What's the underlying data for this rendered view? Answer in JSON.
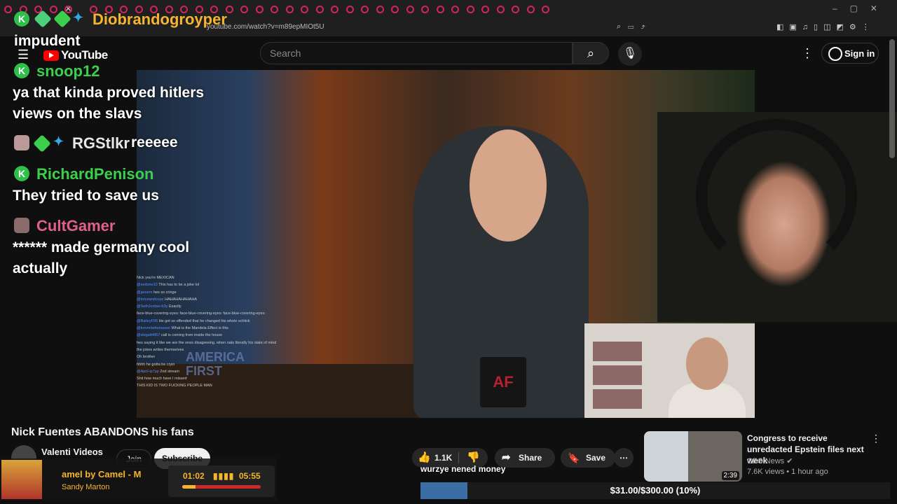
{
  "browser": {
    "url": "youtube.com/watch?v=m89epMIOt5U"
  },
  "youtube": {
    "logo_text": "YouTube",
    "search_placeholder": "Search",
    "sign_in": "Sign in"
  },
  "overlay_chat": {
    "messages": [
      {
        "user": "Diobrandogroyper",
        "color": "#f5b52e",
        "text": "impudent"
      },
      {
        "user": "snoop12",
        "color": "#3ccf4e",
        "text": "ya that kinda proved hitlers views on the slavs"
      },
      {
        "user": "RGStlkr",
        "color": "#e8e8e8",
        "text": "reeeee"
      },
      {
        "user": "RichardPenison",
        "color": "#3ccf4e",
        "text": "They tried to save us"
      },
      {
        "user": "CultGamer",
        "color": "#e0608a",
        "text": "****** made germany cool actually"
      }
    ]
  },
  "video_chat": {
    "lines": [
      {
        "user": "",
        "text": "Nick you're MEXICAN"
      },
      {
        "user": "@sedone10",
        "text": "This has to be a joke lol"
      },
      {
        "user": "@jareem",
        "text": "hes so cringe"
      },
      {
        "user": "@briceandcope",
        "text": "HAHAHAHAHAHA"
      },
      {
        "user": "@SethJordan-b3y",
        "text": "Exactly"
      },
      {
        "user": "",
        "text": "face-blue-covering-eyes: face-blue-covering-eyes: face-blue-covering-eyes:"
      },
      {
        "user": "@BaileyF96",
        "text": "He got so offended that he changed his whole schtick"
      },
      {
        "user": "@trevorbettsmason",
        "text": "What is the Mandela Effect is this"
      },
      {
        "user": "@sbigail4957",
        "text": "call is coming from inside the house"
      },
      {
        "user": "",
        "text": "hes saying it like we are the ones disagreeing. when nats literally his state of mind"
      },
      {
        "user": "",
        "text": "the jokes writes themselves"
      },
      {
        "user": "",
        "text": "Oh brother"
      },
      {
        "user": "",
        "text": "hhhh he gotta be cryin"
      },
      {
        "user": "@April-ip7pp",
        "text": "2nd stream"
      },
      {
        "user": "",
        "text": "Shit how much have I missed"
      },
      {
        "user": "",
        "text": "THIS KID IS TWO FUCKING PEOPLE MAN"
      }
    ],
    "flag_text": "AMERICA FIRST",
    "mug_text": "AF"
  },
  "watch": {
    "title": "Nick Fuentes ABANDONS his fans",
    "channel": "Valenti Videos",
    "join": "Join",
    "subscribe": "Subscribe",
    "likes": "1.1K",
    "share": "Share",
    "save": "Save"
  },
  "recommendation": {
    "title": "Congress to receive unredacted Epstein files next week",
    "channel": "CBS News",
    "meta": "7.6K views • 1 hour ago",
    "duration": "2:39"
  },
  "music_widget": {
    "title": "amel by Camel - M",
    "artist": "Sandy Marton",
    "current": "01:02",
    "total": "05:55",
    "progress": 0.17
  },
  "caption": "wurzye nened money",
  "goal": {
    "text": "$31.00/$300.00 (10%)",
    "progress": 0.1
  },
  "colors": {
    "youtube_red": "#ff0000",
    "goal_fill": "#3b6ea5",
    "music_accent": "#f5b52e"
  }
}
